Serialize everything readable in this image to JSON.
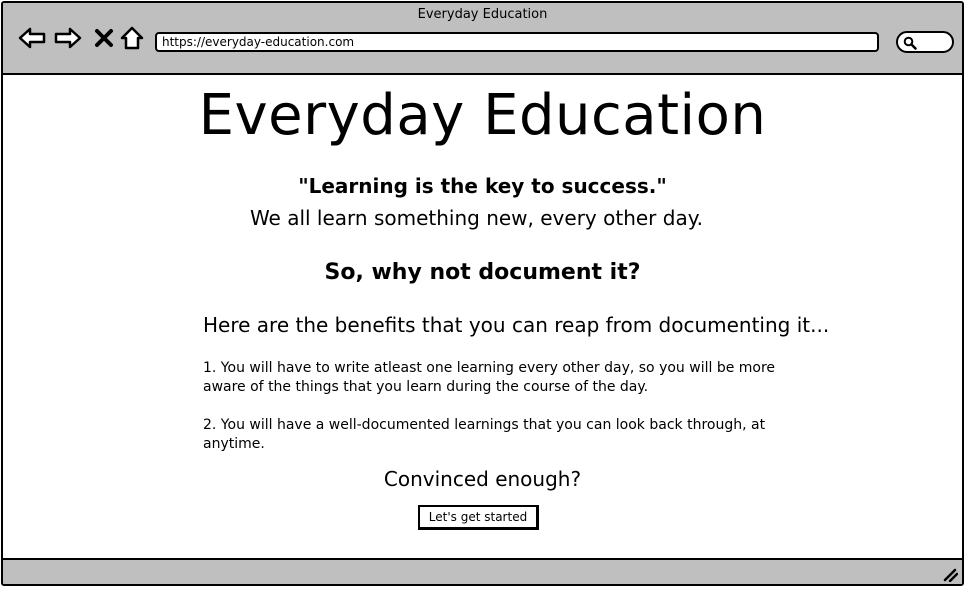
{
  "window": {
    "title": "Everyday Education"
  },
  "toolbar": {
    "back_icon": "back-arrow-icon",
    "forward_icon": "forward-arrow-icon",
    "stop_icon": "close-icon",
    "home_icon": "home-icon",
    "url": "https://everyday-education.com",
    "search_icon": "search-icon"
  },
  "page": {
    "title": "Everyday Education",
    "quote": "\"Learning is the key to success.\"",
    "subline": "We all learn something new, every other day.",
    "question": "So, why not document it?",
    "benefits_intro": "Here are the benefits that you can reap from documenting it...",
    "benefits": [
      "1. You will have to write atleast one learning every other day, so you will be more aware of the things that you learn during the course of the day.",
      "2. You will have a well-documented learnings that you can look back through, at anytime."
    ],
    "convinced": "Convinced enough?",
    "cta_label": "Let's get started"
  },
  "colors": {
    "chrome": "#bfbfbf",
    "background": "#ffffff",
    "ink": "#000000"
  }
}
